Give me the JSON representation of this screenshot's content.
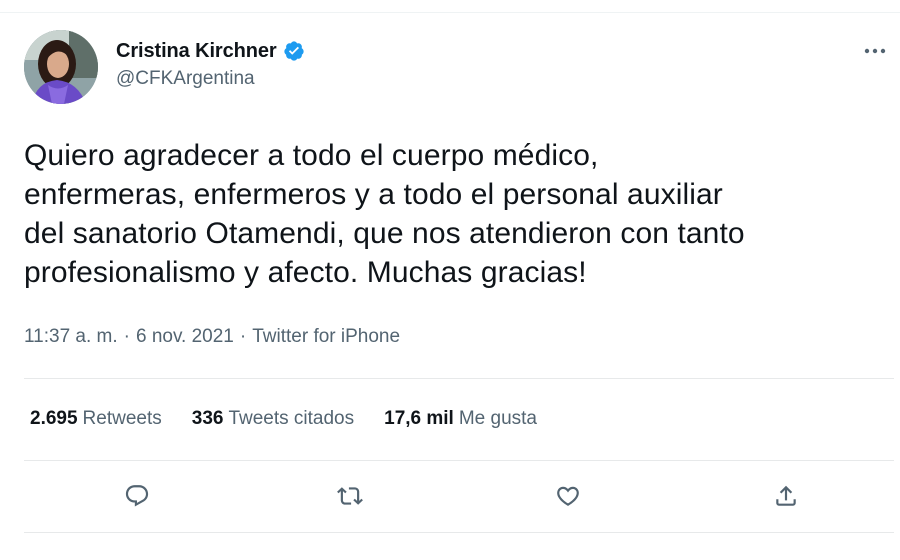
{
  "author": {
    "display_name": "Cristina Kirchner",
    "handle": "@CFKArgentina",
    "avatar_icon": "user-avatar",
    "verified_icon": "verified-badge-icon",
    "verified_color": "#1d9bf0"
  },
  "tweet": {
    "text": "Quiero agradecer a todo el cuerpo médico,\nenfermeras, enfermeros y a todo el personal auxiliar\ndel sanatorio Otamendi, que nos atendieron con tanto\nprofesionalismo y afecto. Muchas gracias!"
  },
  "meta": {
    "time": "11:37 a. m.",
    "separator": "·",
    "date": "6 nov. 2021",
    "source": "Twitter for iPhone"
  },
  "stats": {
    "retweets_count": "2.695",
    "retweets_label": "Retweets",
    "quotes_count": "336",
    "quotes_label": "Tweets citados",
    "likes_count": "17,6 mil",
    "likes_label": "Me gusta"
  },
  "actions": {
    "reply_icon": "reply-icon",
    "retweet_icon": "retweet-icon",
    "like_icon": "heart-icon",
    "share_icon": "share-icon"
  },
  "colors": {
    "primary_text": "#0f1419",
    "secondary_text": "#536471",
    "divider": "#e7e9ea",
    "accent": "#1d9bf0"
  }
}
